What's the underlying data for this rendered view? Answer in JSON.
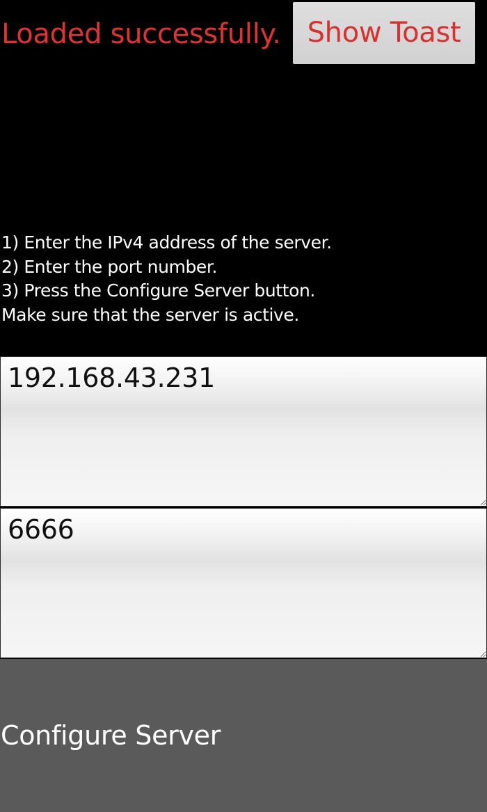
{
  "status": {
    "text": "Loaded successfully.",
    "color": "#e2312e"
  },
  "toast_button": {
    "label": "Show Toast",
    "color": "#d8302d"
  },
  "instructions": [
    "1) Enter the IPv4 address of the server.",
    "2) Enter the port number.",
    "3) Press the Configure Server button.",
    "Make sure that the server is active."
  ],
  "ip_field": {
    "value": "192.168.43.231"
  },
  "port_field": {
    "value": "6666"
  },
  "configure_button": {
    "label": "Configure Server",
    "background": "#5a5a5a"
  }
}
